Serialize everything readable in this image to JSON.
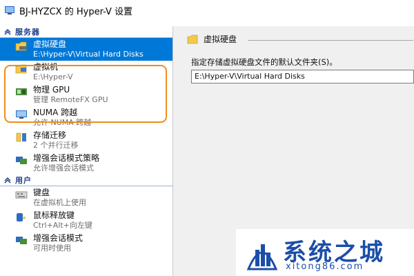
{
  "window": {
    "title": "BJ-HYZCX 的 Hyper-V 设置"
  },
  "sections": {
    "server": {
      "label": "服务器"
    },
    "user": {
      "label": "用户"
    }
  },
  "server_items": [
    {
      "name": "虚拟硬盘",
      "detail": "E:\\Hyper-V\\Virtual Hard Disks",
      "icon": "hard-disk-folder-icon",
      "selected": true
    },
    {
      "name": "虚拟机",
      "detail": "E:\\Hyper-V",
      "icon": "virtual-machine-folder-icon"
    },
    {
      "name": "物理 GPU",
      "detail": "管理 RemoteFX GPU",
      "icon": "gpu-icon"
    },
    {
      "name": "NUMA 跨越",
      "detail": "允许 NUMA 跨越",
      "icon": "numa-icon"
    },
    {
      "name": "存储迁移",
      "detail": "2 个并行迁移",
      "icon": "storage-migration-icon"
    },
    {
      "name": "增强会话模式策略",
      "detail": "允许增强会话模式",
      "icon": "enhanced-session-policy-icon"
    }
  ],
  "user_items": [
    {
      "name": "键盘",
      "detail": "在虚拟机上使用",
      "icon": "keyboard-icon"
    },
    {
      "name": "鼠标释放键",
      "detail": "Ctrl+Alt+向左键",
      "icon": "mouse-icon"
    },
    {
      "name": "增强会话模式",
      "detail": "可用时使用",
      "icon": "enhanced-session-icon"
    }
  ],
  "panel": {
    "title": "虚拟硬盘",
    "description": "指定存储虚拟硬盘文件的默认文件夹(S)。",
    "path_value": "E:\\Hyper-V\\Virtual Hard Disks"
  },
  "watermark": {
    "text": "系统之城",
    "url": "xitong86.com"
  },
  "colors": {
    "selection": "#0078d7",
    "section_text": "#1e3c8a",
    "highlight_border": "#f08c1e",
    "watermark": "#1b4ea8"
  }
}
